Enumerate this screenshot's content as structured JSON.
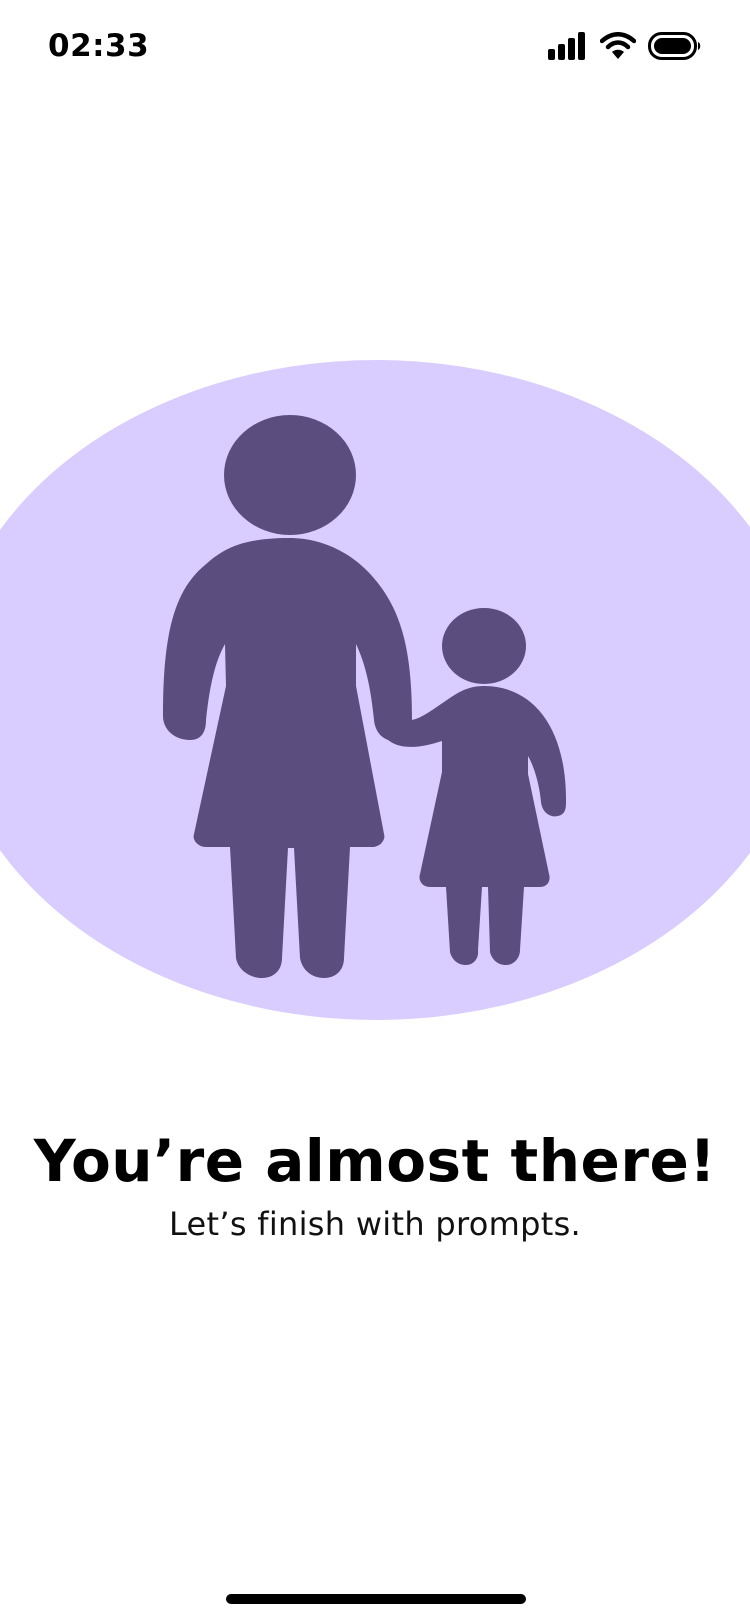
{
  "status_bar": {
    "time": "02:33",
    "icons": [
      "signal-bars-icon",
      "wifi-icon",
      "battery-icon"
    ]
  },
  "illustration": {
    "icon": "parent-and-child-icon",
    "background_color": "#d9ccff",
    "figure_color": "#5b4e7e"
  },
  "content": {
    "headline": "You’re almost there!",
    "subhead": "Let’s finish with prompts."
  }
}
